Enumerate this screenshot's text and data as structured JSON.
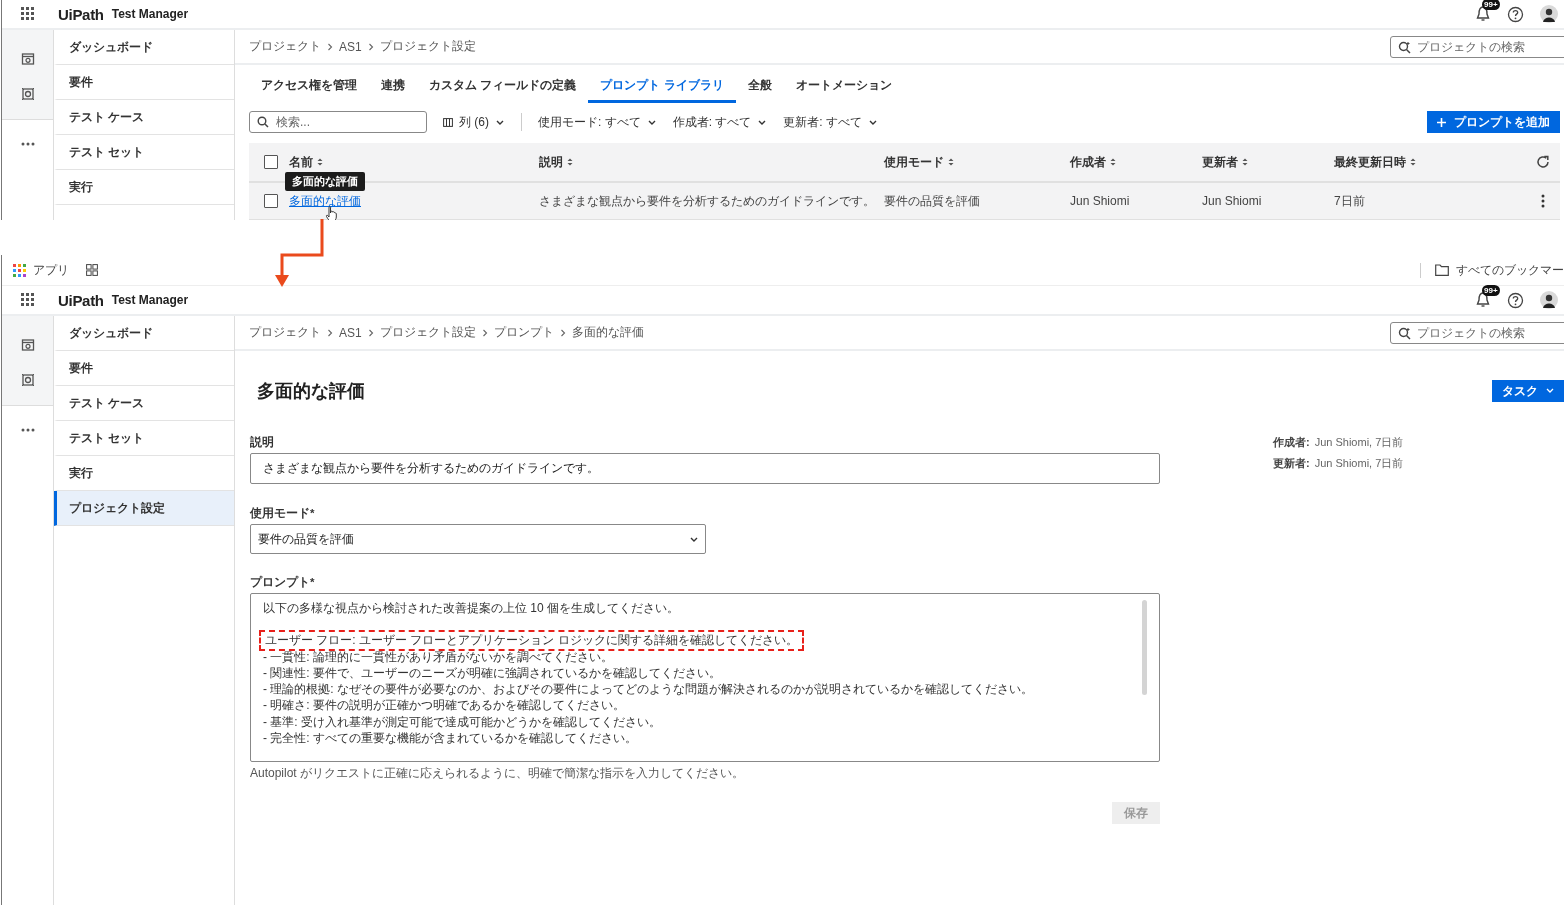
{
  "top_screen": {
    "app_header": {
      "logo": "UiPath",
      "product": "Test Manager",
      "notification_badge": "99+"
    },
    "sidebar": {
      "items": [
        {
          "label": "ダッシュボード",
          "selected": false
        },
        {
          "label": "要件",
          "selected": false
        },
        {
          "label": "テスト ケース",
          "selected": false
        },
        {
          "label": "テスト セット",
          "selected": false
        },
        {
          "label": "実行",
          "selected": false
        }
      ]
    },
    "breadcrumb": [
      "プロジェクト",
      "AS1",
      "プロジェクト設定"
    ],
    "project_search": {
      "placeholder": "プロジェクトの検索"
    },
    "tabs": [
      {
        "label": "アクセス権を管理",
        "selected": false
      },
      {
        "label": "連携",
        "selected": false
      },
      {
        "label": "カスタム フィールドの定義",
        "selected": false
      },
      {
        "label": "プロンプト ライブラリ",
        "selected": true
      },
      {
        "label": "全般",
        "selected": false
      },
      {
        "label": "オートメーション",
        "selected": false
      }
    ],
    "toolbar": {
      "search": {
        "placeholder": "検索..."
      },
      "columns_button": "列 (6)",
      "filters": [
        "使用モード: すべて",
        "作成者: すべて",
        "更新者: すべて"
      ],
      "add_button": "プロンプトを追加"
    },
    "table": {
      "select_all_checked": false,
      "columns": [
        "名前",
        "説明",
        "使用モード",
        "作成者",
        "更新者",
        "最終更新日時"
      ],
      "rows": [
        {
          "checked": false,
          "cells": [
            "多面的な評価",
            "さまざまな観点から要件を分析するためのガイドラインです。",
            "要件の品質を評価",
            "Jun Shiomi",
            "Jun Shiomi",
            "7日前"
          ]
        }
      ],
      "tooltip": "多面的な評価"
    }
  },
  "bottom_screen": {
    "bookmarks_bar": {
      "apps": "アプリ",
      "all_bookmarks": "すべてのブックマー"
    },
    "app_header": {
      "logo": "UiPath",
      "product": "Test Manager",
      "notification_badge": "99+"
    },
    "sidebar": {
      "items": [
        {
          "label": "ダッシュボード",
          "selected": false
        },
        {
          "label": "要件",
          "selected": false
        },
        {
          "label": "テスト ケース",
          "selected": false
        },
        {
          "label": "テスト セット",
          "selected": false
        },
        {
          "label": "実行",
          "selected": false
        },
        {
          "label": "プロジェクト設定",
          "selected": true
        }
      ]
    },
    "breadcrumb": [
      "プロジェクト",
      "AS1",
      "プロジェクト設定",
      "プロンプト",
      "多面的な評価"
    ],
    "project_search": {
      "placeholder": "プロジェクトの検索"
    },
    "title": "多面的な評価",
    "task_button": "タスク",
    "meta": [
      {
        "label": "作成者:",
        "value": "Jun Shiomi, 7日前"
      },
      {
        "label": "更新者:",
        "value": "Jun Shiomi, 7日前"
      }
    ],
    "form": {
      "description": {
        "label": "説明",
        "value": "さまざまな観点から要件を分析するためのガイドラインです。"
      },
      "usage_mode": {
        "label": "使用モード*",
        "value": "要件の品質を評価"
      },
      "prompt": {
        "label": "プロンプト*",
        "lines": [
          {
            "text": "以下の多様な視点から検討された改善提案の上位 10 個を生成してください。",
            "highlighted": false
          },
          {
            "text": "ユーザー フロー: ユーザー フローとアプリケーション ロジックに関する詳細を確認してください。",
            "highlighted": true
          },
          {
            "text": "- 一貫性: 論理的に一貫性があり矛盾がないかを調べてください。",
            "highlighted": false
          },
          {
            "text": "- 関連性: 要件で、ユーザーのニーズが明確に強調されているかを確認してください。",
            "highlighted": false
          },
          {
            "text": "- 理論的根拠: なぜその要件が必要なのか、およびその要件によってどのような問題が解決されるのかが説明されているかを確認してください。",
            "highlighted": false
          },
          {
            "text": "- 明確さ: 要件の説明が正確かつ明確であるかを確認してください。",
            "highlighted": false
          },
          {
            "text": "- 基準: 受け入れ基準が測定可能で達成可能かどうかを確認してください。",
            "highlighted": false
          },
          {
            "text": "- 完全性: すべての重要な機能が含まれているかを確認してください。",
            "highlighted": false
          }
        ],
        "helper": "Autopilot がリクエストに正確に応えられるように、明確で簡潔な指示を入力してください。"
      },
      "save_button": {
        "label": "保存",
        "disabled": true
      }
    }
  }
}
